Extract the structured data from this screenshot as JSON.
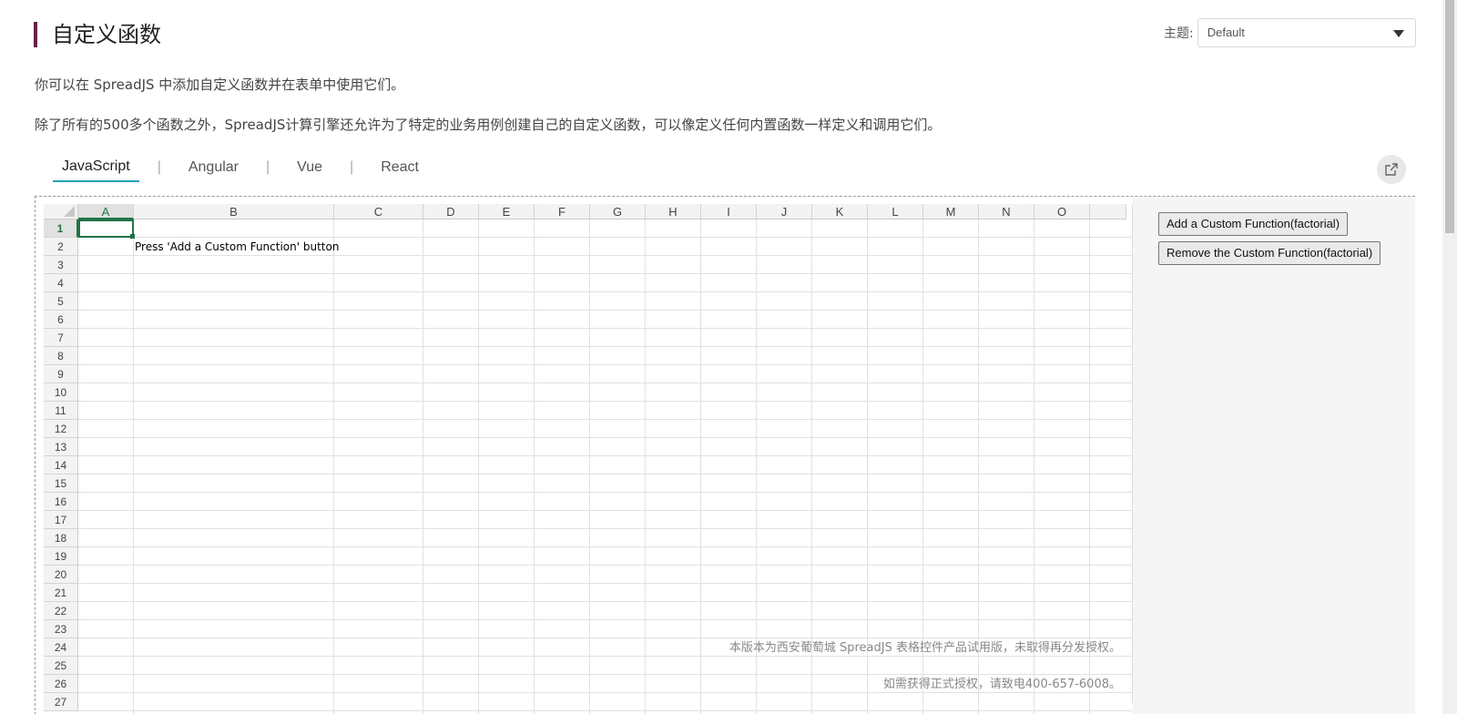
{
  "page": {
    "title": "自定义函数",
    "theme_label": "主题:",
    "theme_value": "Default",
    "desc1": "你可以在 SpreadJS 中添加自定义函数并在表单中使用它们。",
    "desc2": "除了所有的500多个函数之外，SpreadJS计算引擎还允许为了特定的业务用例创建自己的自定义函数，可以像定义任何内置函数一样定义和调用它们。",
    "accent_color": "#6b1f4b",
    "tab_accent_color": "#1aa3b6"
  },
  "tabs": [
    {
      "label": "JavaScript",
      "active": true
    },
    {
      "label": "Angular",
      "active": false
    },
    {
      "label": "Vue",
      "active": false
    },
    {
      "label": "React",
      "active": false
    }
  ],
  "spreadsheet": {
    "columns": [
      "A",
      "B",
      "C",
      "D",
      "E",
      "F",
      "G",
      "H",
      "I",
      "J",
      "K",
      "L",
      "M",
      "N",
      "O"
    ],
    "rows": [
      "1",
      "2",
      "3",
      "4",
      "5",
      "6",
      "7",
      "8",
      "9",
      "10",
      "11",
      "12",
      "13",
      "14",
      "15",
      "16",
      "17",
      "18",
      "19",
      "20",
      "21",
      "22",
      "23",
      "24",
      "25",
      "26",
      "27"
    ],
    "selected_cell": "A1",
    "cell_b2": "Press 'Add a Custom Function' button",
    "watermark_line1": "本版本为西安葡萄城 SpreadJS 表格控件产品试用版，未取得再分发授权。",
    "watermark_line2": "如需获得正式授权，请致电400-657-6008。",
    "grid_color": "#217346"
  },
  "options": {
    "add_button": "Add a Custom Function(factorial)",
    "remove_button": "Remove the Custom Function(factorial)"
  },
  "icons": {
    "open_in_new": "open-new-window-icon",
    "dropdown": "chevron-down-icon"
  }
}
